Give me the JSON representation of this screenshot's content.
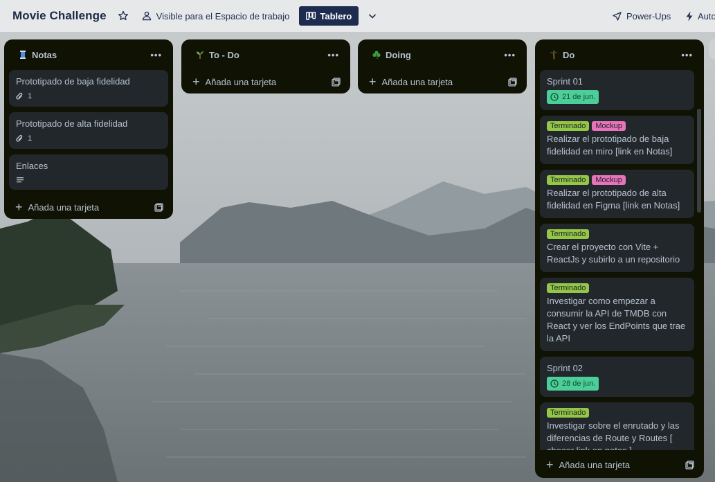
{
  "board": {
    "title": "Movie Challenge",
    "visibility": "Visible para el Espacio de trabajo",
    "view": "Tablero",
    "powerups": "Power-Ups",
    "automation": "Auto"
  },
  "lists": [
    {
      "title": "Notas",
      "emoji": "spool-icon",
      "cards": [
        {
          "title": "Prototipado de baja fidelidad",
          "attachments": "1"
        },
        {
          "title": "Prototipado de alta fidelidad",
          "attachments": "1"
        },
        {
          "title": "Enlaces",
          "has_description": true
        }
      ],
      "add_label": "Añada una tarjeta"
    },
    {
      "title": "To - Do",
      "emoji": "seedling-icon",
      "cards": [],
      "add_label": "Añada una tarjeta"
    },
    {
      "title": "Doing",
      "emoji": "shamrock-icon",
      "cards": [],
      "add_label": "Añada una tarjeta"
    },
    {
      "title": "Do",
      "emoji": "palm-tree-icon",
      "cards": [
        {
          "title": "Sprint 01",
          "due": "21 de jun."
        },
        {
          "labels": [
            "Terminado",
            "Mockup"
          ],
          "title": "Realizar el prototipado de baja fidelidad en miro [link en Notas]"
        },
        {
          "labels": [
            "Terminado",
            "Mockup"
          ],
          "title": "Realizar el prototipado de alta fidelidad en Figma [link en Notas]"
        },
        {
          "labels": [
            "Terminado"
          ],
          "title": "Crear el proyecto con Vite + ReactJs y subirlo a un repositorio"
        },
        {
          "labels": [
            "Terminado"
          ],
          "title": "Investigar como empezar a consumir la API de TMDB con React y ver los EndPoints que trae la API"
        },
        {
          "title": "Sprint 02",
          "due": "28 de jun."
        },
        {
          "labels": [
            "Terminado"
          ],
          "title": "Investigar sobre el enrutado y las diferencias de Route y Routes [ checar link en notas ]",
          "has_description": true
        }
      ],
      "add_label": "Añada una tarjeta"
    }
  ],
  "colors": {
    "list_bg": "#101204",
    "card_bg": "#22272b",
    "label_green": "#94c748",
    "label_pink": "#e774bb",
    "due_green": "#4bce97",
    "view_button": "#1d2b4f"
  }
}
